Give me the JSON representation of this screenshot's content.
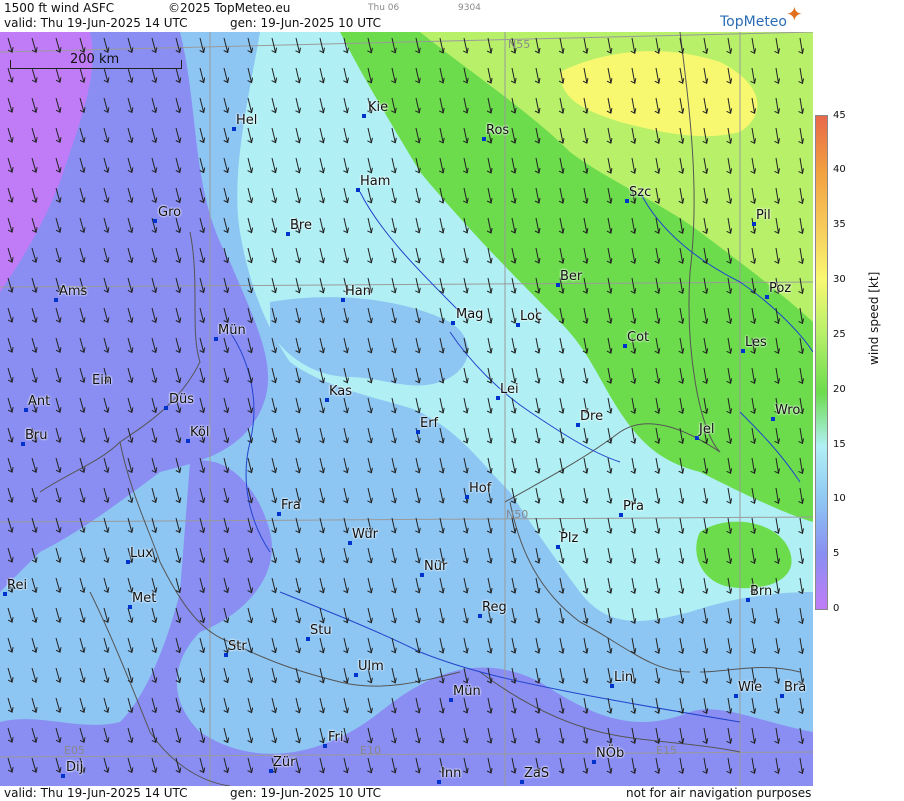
{
  "header": {
    "product": "1500 ft wind ASFC",
    "copyright": "©2025 TopMeteo.eu",
    "run_day": "Thu 06",
    "code": "9304",
    "valid": "valid:  Thu  19-Jun-2025  14 UTC",
    "generated": "gen: 19-Jun-2025 10 UTC",
    "logo": "TopMeteo"
  },
  "footer": {
    "valid": "valid:  Thu  19-Jun-2025  14 UTC",
    "generated": "gen: 19-Jun-2025 10 UTC",
    "disclaimer": "not for air navigation purposes"
  },
  "scale_bar": "200 km",
  "grid_labels": {
    "lat_55": "N55",
    "lat_50": "N50",
    "lon_05": "E05",
    "lon_10": "E10",
    "lon_15": "E15"
  },
  "cities": [
    {
      "name": "Kie"
    },
    {
      "name": "Hel"
    },
    {
      "name": "Ros"
    },
    {
      "name": "Ham"
    },
    {
      "name": "Gro"
    },
    {
      "name": "Szc"
    },
    {
      "name": "Bre"
    },
    {
      "name": "Pil"
    },
    {
      "name": "Ber"
    },
    {
      "name": "Ams"
    },
    {
      "name": "Han"
    },
    {
      "name": "Poz"
    },
    {
      "name": "Mag"
    },
    {
      "name": "Loc"
    },
    {
      "name": "Mün"
    },
    {
      "name": "Cot"
    },
    {
      "name": "Les"
    },
    {
      "name": "Ein"
    },
    {
      "name": "Kas"
    },
    {
      "name": "Lei"
    },
    {
      "name": "Ant"
    },
    {
      "name": "Düs"
    },
    {
      "name": "Wro"
    },
    {
      "name": "Dre"
    },
    {
      "name": "Erf"
    },
    {
      "name": "Köl"
    },
    {
      "name": "Jel"
    },
    {
      "name": "Bru"
    },
    {
      "name": "Hof"
    },
    {
      "name": "Fra"
    },
    {
      "name": "Pra"
    },
    {
      "name": "Wür"
    },
    {
      "name": "Plz"
    },
    {
      "name": "Lux"
    },
    {
      "name": "Nür"
    },
    {
      "name": "Rei"
    },
    {
      "name": "Brn"
    },
    {
      "name": "Met"
    },
    {
      "name": "Reg"
    },
    {
      "name": "Stu"
    },
    {
      "name": "Str"
    },
    {
      "name": "Ulm"
    },
    {
      "name": "Lin"
    },
    {
      "name": "Wie"
    },
    {
      "name": "Bra"
    },
    {
      "name": "Mün"
    },
    {
      "name": "Fri"
    },
    {
      "name": "NÖb"
    },
    {
      "name": "Dij"
    },
    {
      "name": "Zür"
    },
    {
      "name": "Inn"
    },
    {
      "name": "ZaS"
    }
  ],
  "legend": {
    "title": "wind speed [kt]",
    "ticks": [
      "45",
      "40",
      "35",
      "30",
      "25",
      "20",
      "15",
      "10",
      "5",
      "0"
    ],
    "colors": [
      "#e8684a",
      "#f2a040",
      "#f7c95a",
      "#f8f870",
      "#b8f06a",
      "#6cdc4c",
      "#b0f0f5",
      "#8ec6f3",
      "#8a8ef2",
      "#c07cf7"
    ]
  },
  "colors": {
    "band_0_5": "#c07cf7",
    "band_5_10": "#8a8ef2",
    "band_10_15": "#8ec6f3",
    "band_15_20": "#b0f0f5",
    "band_20_25": "#6cdc4c",
    "band_25_30": "#b8f06a",
    "band_30_35": "#f8f870",
    "borders": "#555555",
    "rivers": "#2244cc",
    "city_marker": "#0033cc"
  }
}
